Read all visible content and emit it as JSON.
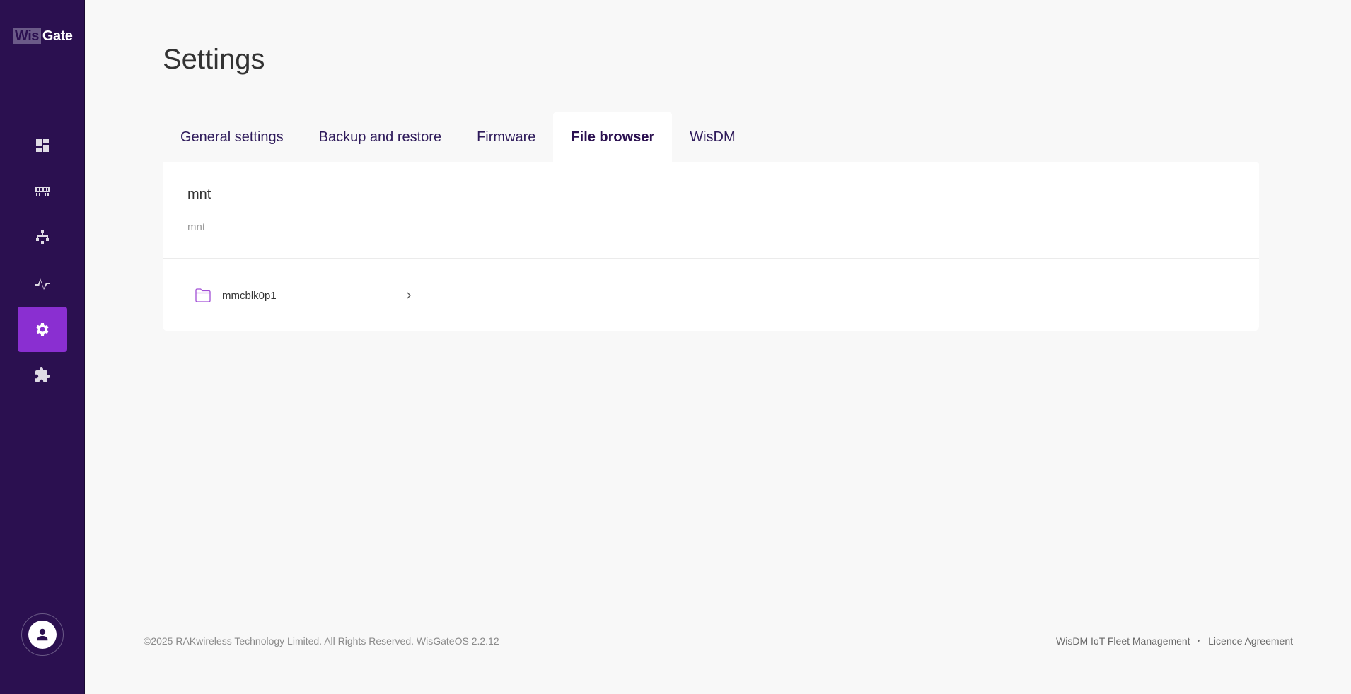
{
  "brand": {
    "logo_part1": "Wis",
    "logo_part2": "Gate"
  },
  "sidebar": {
    "items": [
      {
        "name": "dashboard",
        "icon": "dashboard-icon"
      },
      {
        "name": "gateway",
        "icon": "gateway-icon"
      },
      {
        "name": "network",
        "icon": "network-icon"
      },
      {
        "name": "activity",
        "icon": "activity-icon"
      },
      {
        "name": "settings",
        "icon": "gear-icon",
        "active": true
      },
      {
        "name": "extensions",
        "icon": "puzzle-icon"
      }
    ],
    "profile_icon": "user-icon"
  },
  "page": {
    "title": "Settings"
  },
  "tabs": [
    {
      "label": "General settings"
    },
    {
      "label": "Backup and restore"
    },
    {
      "label": "Firmware"
    },
    {
      "label": "File browser",
      "active": true
    },
    {
      "label": "WisDM"
    }
  ],
  "file_browser": {
    "current_dir": "mnt",
    "breadcrumb": "mnt",
    "entries": [
      {
        "name": "mmcblk0p1",
        "type": "folder",
        "icon": "folder-icon"
      }
    ]
  },
  "footer": {
    "copyright": "©2025 RAKwireless Technology Limited. All Rights Reserved. WisGateOS 2.2.12",
    "link1": "WisDM IoT Fleet Management",
    "separator": "•",
    "link2": "Licence Agreement"
  },
  "colors": {
    "sidebar_bg": "#2b1050",
    "accent": "#8a2fd1",
    "page_bg": "#f8f8f8"
  }
}
